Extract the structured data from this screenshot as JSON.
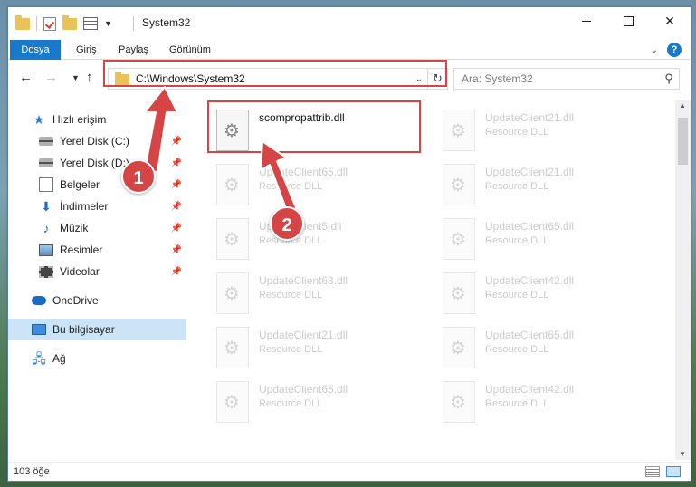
{
  "window": {
    "title": "System32",
    "min_label": "",
    "max_label": "",
    "close_label": "✕"
  },
  "ribbon": {
    "tabs": [
      {
        "label": "Dosya"
      },
      {
        "label": "Giriş"
      },
      {
        "label": "Paylaş"
      },
      {
        "label": "Görünüm"
      }
    ]
  },
  "navbar": {
    "address": "C:\\Windows\\System32",
    "search_placeholder": "Ara: System32"
  },
  "sidebar": {
    "items": [
      {
        "label": "Hızlı erişim",
        "icon": "star-icon"
      },
      {
        "label": "Yerel Disk (C:)",
        "icon": "drive-icon",
        "pinned": true
      },
      {
        "label": "Yerel Disk (D:)",
        "icon": "drive-icon",
        "pinned": true
      },
      {
        "label": "Belgeler",
        "icon": "document-icon",
        "pinned": true
      },
      {
        "label": "İndirmeler",
        "icon": "download-icon",
        "pinned": true
      },
      {
        "label": "Müzik",
        "icon": "music-icon",
        "pinned": true
      },
      {
        "label": "Resimler",
        "icon": "pictures-icon",
        "pinned": true
      },
      {
        "label": "Videolar",
        "icon": "video-icon",
        "pinned": true
      },
      {
        "label": "OneDrive",
        "icon": "cloud-icon"
      },
      {
        "label": "Bu bilgisayar",
        "icon": "computer-icon",
        "selected": true
      },
      {
        "label": "Ağ",
        "icon": "network-icon"
      }
    ]
  },
  "files": [
    {
      "name": "scompropattrib.dll",
      "type": "",
      "highlighted": true
    },
    {
      "name": "UpdateClient21.dll",
      "type": "Resource DLL"
    },
    {
      "name": "UpdateClient65.dll",
      "type": "Resource DLL"
    },
    {
      "name": "UpdateClient21.dll",
      "type": "Resource DLL"
    },
    {
      "name": "UpdateClient5.dll",
      "type": "Resource DLL"
    },
    {
      "name": "UpdateClient65.dll",
      "type": "Resource DLL"
    },
    {
      "name": "UpdateClient63.dll",
      "type": "Resource DLL"
    },
    {
      "name": "UpdateClient42.dll",
      "type": "Resource DLL"
    },
    {
      "name": "UpdateClient21.dll",
      "type": "Resource DLL"
    },
    {
      "name": "UpdateClient65.dll",
      "type": "Resource DLL"
    },
    {
      "name": "UpdateClient65.dll",
      "type": "Resource DLL"
    },
    {
      "name": "UpdateClient42.dll",
      "type": "Resource DLL"
    }
  ],
  "status": {
    "count": "103 öğe"
  },
  "callouts": {
    "one": "1",
    "two": "2",
    "color": "#d64545"
  }
}
